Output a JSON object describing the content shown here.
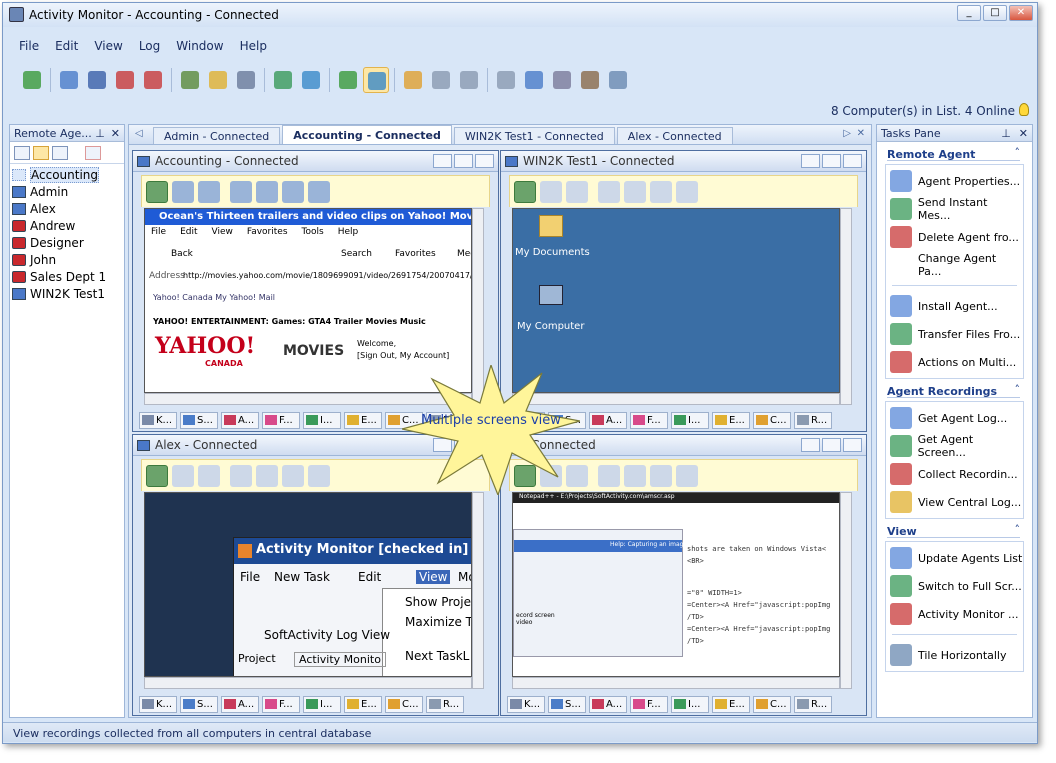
{
  "window": {
    "title": "Activity Monitor - Accounting - Connected"
  },
  "menu": [
    "File",
    "Edit",
    "View",
    "Log",
    "Window",
    "Help"
  ],
  "status_right": "8 Computer(s) in List. 4 Online",
  "remote_agents": {
    "title": "Remote Age...",
    "items": [
      {
        "name": "Accounting",
        "type": "computer"
      },
      {
        "name": "Admin",
        "type": "computer"
      },
      {
        "name": "Alex",
        "type": "computer"
      },
      {
        "name": "Andrew",
        "type": "offline"
      },
      {
        "name": "Designer",
        "type": "offline"
      },
      {
        "name": "John",
        "type": "offline"
      },
      {
        "name": "Sales Dept 1",
        "type": "offline"
      },
      {
        "name": "WIN2K Test1",
        "type": "computer"
      }
    ]
  },
  "tabs": [
    {
      "label": "Admin - Connected",
      "active": false
    },
    {
      "label": "Accounting - Connected",
      "active": true
    },
    {
      "label": "WIN2K Test1 - Connected",
      "active": false
    },
    {
      "label": "Alex - Connected",
      "active": false
    }
  ],
  "monitors": [
    {
      "title": "Accounting - Connected",
      "screen": "browser"
    },
    {
      "title": "WIN2K Test1 - Connected",
      "screen": "desktop"
    },
    {
      "title": "Alex - Connected",
      "screen": "app"
    },
    {
      "title": "- Connected",
      "screen": "notepad"
    }
  ],
  "app_tabs": [
    "K...",
    "S...",
    "A...",
    "F...",
    "I...",
    "E...",
    "C...",
    "R..."
  ],
  "browser": {
    "title": "Ocean's Thirteen trailers and video clips on Yahoo! Movies - Micros",
    "menu": [
      "File",
      "Edit",
      "View",
      "Favorites",
      "Tools",
      "Help"
    ],
    "back": "Back",
    "search": "Search",
    "favorites": "Favorites",
    "media": "Med",
    "address_label": "Address",
    "address": "http://movies.yahoo.com/movie/1809699091/video/2691754/20070417/94/",
    "links": "Yahoo! Canada  My Yahoo!  Mail",
    "nav": "YAHOO! ENTERTAINMENT:   Games: GTA4 Trailer   Movies   Music",
    "logo": "YAHOO!",
    "logo_sub": "CANADA",
    "movies": "MOVIES",
    "welcome": "Welcome,",
    "signout": "[Sign Out, My Account]"
  },
  "desktop": {
    "icons": [
      "My Documents",
      "My Computer"
    ]
  },
  "alexapp": {
    "title": "Activity Monitor [checked in]",
    "menu": [
      "File",
      "New Task",
      "Edit",
      "View",
      "Move"
    ],
    "dropdown": [
      "Show Proje",
      "Maximize Ta",
      "Next TaskL"
    ],
    "log": "SoftActivity Log View",
    "project": "Project",
    "project_value": "Activity Monito"
  },
  "notepad": {
    "title": "Notepad++ - E:\\Projects\\SoftActivity.com\\amscr.asp",
    "caption": "Help: Capturing an image",
    "code": [
      "shots are taken on Windows Vista<",
      "<BR>",
      "=\"0\" WIDTH=1>",
      "=Center><A Href=\"javascript:popImg",
      "/TD>",
      "=Center><A Href=\"javascript:popImg",
      "/TD>"
    ],
    "caption2": "ecord screen video"
  },
  "callout": "Multiple screens view",
  "tasks": {
    "title": "Tasks Pane",
    "sections": [
      {
        "title": "Remote Agent",
        "items": [
          {
            "label": "Agent Properties...",
            "icon": "properties-icon"
          },
          {
            "label": "Send Instant Mes...",
            "icon": "message-icon"
          },
          {
            "label": "Delete Agent fro...",
            "icon": "delete-agent-icon"
          },
          {
            "label": "Change Agent Pa...",
            "icon": ""
          },
          {
            "label": "",
            "icon": "divider"
          },
          {
            "label": "Install Agent...",
            "icon": "install-icon"
          },
          {
            "label": "Transfer Files Fro...",
            "icon": "transfer-icon"
          },
          {
            "label": "Actions on Multi...",
            "icon": "actions-icon"
          }
        ]
      },
      {
        "title": "Agent Recordings",
        "items": [
          {
            "label": "Get Agent Log...",
            "icon": "get-log-icon"
          },
          {
            "label": "Get Agent Screen...",
            "icon": "get-screen-icon"
          },
          {
            "label": "Collect Recordin...",
            "icon": "collect-icon"
          },
          {
            "label": "View Central Log...",
            "icon": "central-log-icon"
          }
        ]
      },
      {
        "title": "View",
        "items": [
          {
            "label": "Update Agents List",
            "icon": "update-icon"
          },
          {
            "label": "Switch to Full Scr...",
            "icon": "fullscreen-icon"
          },
          {
            "label": "Activity Monitor ...",
            "icon": "tools-icon"
          },
          {
            "label": "",
            "icon": "divider"
          },
          {
            "label": "Tile Horizontally",
            "icon": "tile-icon"
          }
        ]
      }
    ]
  },
  "statusbar": "View recordings collected from all computers in central database",
  "colors": {
    "accent": "#1e3f8a",
    "desktop": "#3a6ea5",
    "highlight": "#fde7a6"
  }
}
